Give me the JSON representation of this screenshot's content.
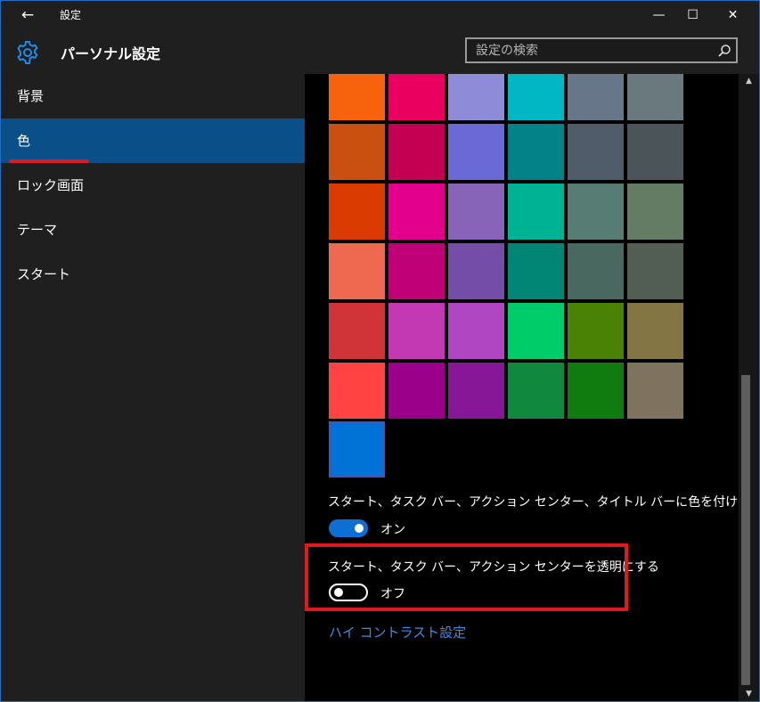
{
  "window": {
    "title": "設定",
    "back_icon": "back-arrow-icon",
    "minimize_icon": "minimize-icon",
    "maximize_icon": "maximize-icon",
    "close_icon": "close-icon"
  },
  "header": {
    "title": "パーソナル設定",
    "icon": "gear-icon",
    "search_placeholder": "設定の検索",
    "search_icon": "search-icon"
  },
  "sidebar": {
    "items": [
      {
        "label": "背景",
        "selected": false
      },
      {
        "label": "色",
        "selected": true
      },
      {
        "label": "ロック画面",
        "selected": false
      },
      {
        "label": "テーマ",
        "selected": false
      },
      {
        "label": "スタート",
        "selected": false
      }
    ]
  },
  "colors": {
    "swatches": [
      [
        "#f7630c",
        "#ea005e",
        "#8e8cd8",
        "#00b7c3",
        "#68768a",
        "#69797e"
      ],
      [
        "#ca5010",
        "#c30052",
        "#6b69d6",
        "#038387",
        "#515c6b",
        "#4a5459"
      ],
      [
        "#da3b01",
        "#e3008c",
        "#8764b8",
        "#00b294",
        "#567c73",
        "#647c64"
      ],
      [
        "#ef6950",
        "#bf0077",
        "#744da9",
        "#018574",
        "#486860",
        "#525e54"
      ],
      [
        "#d13438",
        "#c239b3",
        "#b146c2",
        "#00cc6a",
        "#498205",
        "#847545"
      ],
      [
        "#ff4343",
        "#9a0089",
        "#881798",
        "#10893e",
        "#107c10",
        "#7e735f"
      ]
    ],
    "selected_color": "#0173d6",
    "accent": "#0b6fd3",
    "highlight": "#e0191c"
  },
  "settings": {
    "colorize_label": "スタート、タスク バー、アクション センター、タイトル バーに色を付ける",
    "colorize_state": "オン",
    "colorize_on": true,
    "transparent_label": "スタート、タスク バー、アクション センターを透明にする",
    "transparent_state": "オフ",
    "transparent_on": false,
    "high_contrast_link": "ハイ コントラスト設定"
  }
}
